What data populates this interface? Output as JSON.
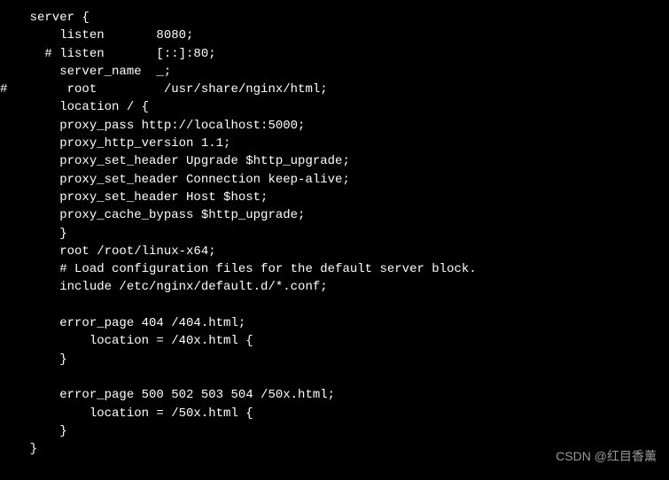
{
  "code": {
    "lines": [
      "    server {",
      "        listen       8080;",
      "      # listen       [::]:80;",
      "        server_name  _;",
      "#        root         /usr/share/nginx/html;",
      "        location / {",
      "        proxy_pass http://localhost:5000;",
      "        proxy_http_version 1.1;",
      "        proxy_set_header Upgrade $http_upgrade;",
      "        proxy_set_header Connection keep-alive;",
      "        proxy_set_header Host $host;",
      "        proxy_cache_bypass $http_upgrade;",
      "        }",
      "        root /root/linux-x64;",
      "        # Load configuration files for the default server block.",
      "        include /etc/nginx/default.d/*.conf;",
      "",
      "        error_page 404 /404.html;",
      "            location = /40x.html {",
      "        }",
      "",
      "        error_page 500 502 503 504 /50x.html;",
      "            location = /50x.html {",
      "        }",
      "    }"
    ]
  },
  "watermark": "CSDN @红目香薰"
}
